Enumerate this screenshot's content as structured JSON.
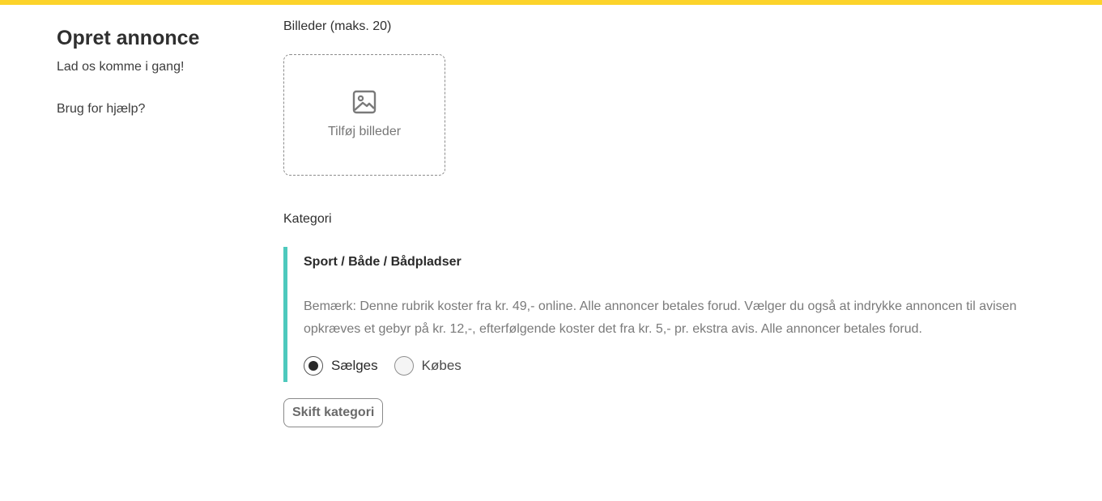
{
  "colors": {
    "top_bar": "#fcd32a",
    "category_accent": "#4ec9bd"
  },
  "sidebar": {
    "title": "Opret annonce",
    "subtitle": "Lad os komme i gang!",
    "help_link": "Brug for hjælp?"
  },
  "images": {
    "label": "Billeder (maks. 20)",
    "upload_text": "Tilføj billeder",
    "upload_icon": "image-icon"
  },
  "category": {
    "label": "Kategori",
    "path": "Sport / Både / Bådpladser",
    "note": "Bemærk: Denne rubrik koster fra kr. 49,- online. Alle annoncer betales forud. Vælger du også at indrykke annoncen til avisen opkræves et gebyr på kr. 12,-, efterfølgende koster det fra kr. 5,- pr. ekstra avis. Alle annoncer betales forud.",
    "options": [
      {
        "label": "Sælges",
        "selected": true
      },
      {
        "label": "Købes",
        "selected": false
      }
    ],
    "change_button": "Skift kategori"
  }
}
